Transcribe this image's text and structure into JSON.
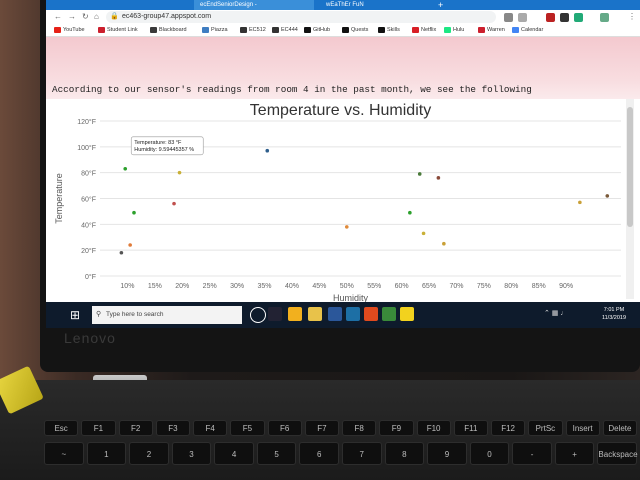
{
  "browser": {
    "tabs": [
      {
        "label": "ecEndSeniorDesign -"
      },
      {
        "label": "wEaThEr FuN"
      }
    ],
    "new_tab_label": "+",
    "url": "ec463-group47.appspot.com",
    "bookmarks": [
      {
        "label": "YouTube",
        "color": "#e62117"
      },
      {
        "label": "Student Link",
        "color": "#cc1f2d"
      },
      {
        "label": "Blackboard",
        "color": "#3a3a3a"
      },
      {
        "label": "Piazza",
        "color": "#3f7dc1"
      },
      {
        "label": "EC512",
        "color": "#333333"
      },
      {
        "label": "EC444",
        "color": "#333333"
      },
      {
        "label": "GitHub",
        "color": "#111111"
      },
      {
        "label": "Quests",
        "color": "#111111"
      },
      {
        "label": "Skills",
        "color": "#111111"
      },
      {
        "label": "Netflix",
        "color": "#d81f26"
      },
      {
        "label": "Hulu",
        "color": "#1ce783"
      },
      {
        "label": "Warren",
        "color": "#cc1f2d"
      },
      {
        "label": "Calendar",
        "color": "#4285f4"
      }
    ]
  },
  "page": {
    "intro": "According to our sensor's readings from room 4 in the past month, we see the following"
  },
  "tooltip": {
    "temp_line": "Temperature: 83 °F",
    "hum_line": "Humidity: 9.59445357 %"
  },
  "taskbar": {
    "search_placeholder": "Type here to search",
    "time": "7:01 PM",
    "date": "11/3/2019"
  },
  "laptop": {
    "brand": "Lenovo"
  },
  "keyboard": {
    "row1": [
      "Esc",
      "F1",
      "F2",
      "F3",
      "F4",
      "F5",
      "F6",
      "F7",
      "F8",
      "F9",
      "F10",
      "F11",
      "F12",
      "PrtSc",
      "Insert",
      "Delete"
    ],
    "row2": [
      "~",
      "1",
      "2",
      "3",
      "4",
      "5",
      "6",
      "7",
      "8",
      "9",
      "0",
      "-",
      "+",
      "Backspace"
    ]
  },
  "chart_data": {
    "type": "scatter",
    "title": "Temperature vs. Humidity",
    "xlabel": "Humidity",
    "ylabel": "Temperature",
    "xlim": [
      5,
      100
    ],
    "ylim": [
      0,
      120
    ],
    "x_ticks": [
      "10%",
      "15%",
      "20%",
      "25%",
      "30%",
      "35%",
      "40%",
      "45%",
      "50%",
      "55%",
      "60%",
      "65%",
      "70%",
      "75%",
      "80%",
      "85%",
      "90%"
    ],
    "y_ticks": [
      "0°F",
      "20°F",
      "40°F",
      "60°F",
      "80°F",
      "100°F",
      "120°F"
    ],
    "grid": true,
    "points": [
      {
        "x": 9.6,
        "y": 83,
        "color": "#2ca02c"
      },
      {
        "x": 8.9,
        "y": 18,
        "color": "#555555"
      },
      {
        "x": 10.5,
        "y": 24,
        "color": "#e07b39"
      },
      {
        "x": 11.2,
        "y": 49,
        "color": "#2ca02c"
      },
      {
        "x": 18.5,
        "y": 56,
        "color": "#c0504d"
      },
      {
        "x": 19.5,
        "y": 80,
        "color": "#c9b037"
      },
      {
        "x": 35.5,
        "y": 97,
        "color": "#2e5e8c"
      },
      {
        "x": 50,
        "y": 38,
        "color": "#e08a39"
      },
      {
        "x": 61.5,
        "y": 49,
        "color": "#2ca02c"
      },
      {
        "x": 63.3,
        "y": 79,
        "color": "#4a7a3a"
      },
      {
        "x": 64,
        "y": 33,
        "color": "#c9b037"
      },
      {
        "x": 66.7,
        "y": 76,
        "color": "#8a4a3a"
      },
      {
        "x": 67.7,
        "y": 25,
        "color": "#c9a037"
      },
      {
        "x": 92.5,
        "y": 57,
        "color": "#c9a037"
      },
      {
        "x": 97.5,
        "y": 62,
        "color": "#7a5a3a"
      }
    ]
  }
}
